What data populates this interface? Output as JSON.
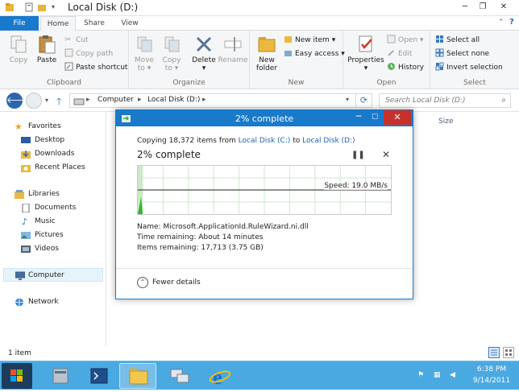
{
  "window": {
    "title": "Local Disk (D:)"
  },
  "ribbon": {
    "tabs": [
      "File",
      "Home",
      "Share",
      "View"
    ],
    "groups": {
      "clipboard": {
        "label": "Clipboard",
        "copy": "Copy",
        "paste": "Paste",
        "cut": "Cut",
        "copy_path": "Copy path",
        "paste_shortcut": "Paste shortcut"
      },
      "organize": {
        "label": "Organize",
        "move_to": "Move",
        "move_to_sub": "to",
        "copy_to": "Copy",
        "copy_to_sub": "to",
        "delete": "Delete",
        "rename": "Rename"
      },
      "new": {
        "label": "New",
        "new_folder_line1": "New",
        "new_folder_line2": "folder",
        "new_item": "New item",
        "easy_access": "Easy access"
      },
      "open": {
        "label": "Open",
        "properties": "Properties",
        "open": "Open",
        "edit": "Edit",
        "history": "History"
      },
      "select": {
        "label": "Select",
        "select_all": "Select all",
        "select_none": "Select none",
        "invert": "Invert selection"
      }
    }
  },
  "address": {
    "crumbs": [
      "Computer",
      "Local Disk (D:)"
    ],
    "search_placeholder": "Search Local Disk (D:)"
  },
  "nav": {
    "favorites": {
      "label": "Favorites",
      "items": [
        "Desktop",
        "Downloads",
        "Recent Places"
      ]
    },
    "libraries": {
      "label": "Libraries",
      "items": [
        "Documents",
        "Music",
        "Pictures",
        "Videos"
      ]
    },
    "computer": "Computer",
    "network": "Network"
  },
  "content": {
    "column_size": "Size"
  },
  "status": {
    "text": "1 item"
  },
  "dialog": {
    "title": "2% complete",
    "copying_prefix": "Copying 18,372 items from ",
    "source": "Local Disk (C:)",
    "copying_mid": " to ",
    "dest": "Local Disk (D:)",
    "percent_label": "2% complete",
    "progress": 0.02,
    "speed": "Speed: 19.0 MB/s",
    "name_line": "Name:  Microsoft.ApplicationId.RuleWizard.ni.dll",
    "time_line": "Time remaining:  About 14 minutes",
    "items_line": "Items remaining:  17,713 (3.75 GB)",
    "fewer_details": "Fewer details"
  },
  "taskbar": {
    "clock_time": "6:38 PM",
    "clock_date": "9/14/2011"
  },
  "colors": {
    "accent": "#1979ca",
    "graph_fill": "#2db52d",
    "close": "#c7312b",
    "taskbar": "#4aa9e1"
  }
}
